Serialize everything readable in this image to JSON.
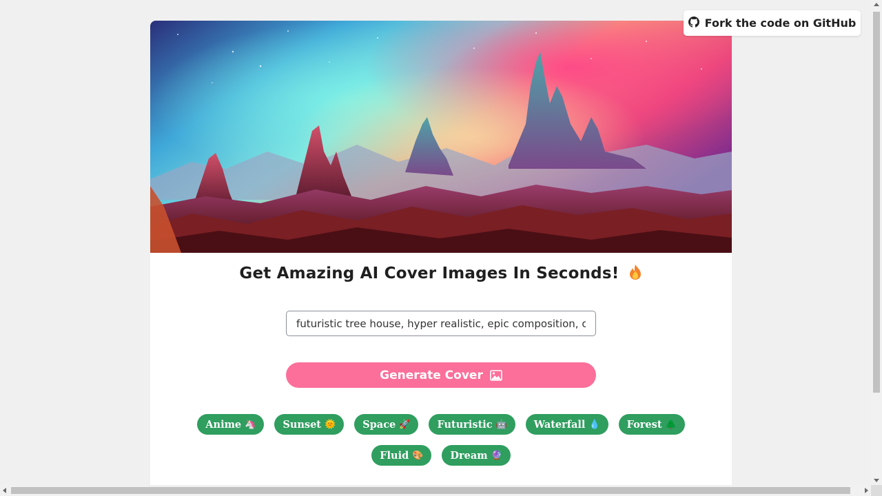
{
  "github": {
    "label": "Fork the code on GitHub",
    "icon": "github-icon"
  },
  "hero": {
    "alt": "AI generated alien mountain landscape under colorful nebula sky"
  },
  "headline": {
    "text": "Get Amazing AI Cover Images In Seconds!",
    "icon": "flame-icon"
  },
  "prompt": {
    "value": "futuristic tree house, hyper realistic, epic composition, cinematic"
  },
  "generate": {
    "label": "Generate Cover",
    "icon": "image-icon"
  },
  "tags": [
    {
      "label": "Anime",
      "emoji": "🦄"
    },
    {
      "label": "Sunset",
      "emoji": "🌞"
    },
    {
      "label": "Space",
      "emoji": "🚀"
    },
    {
      "label": "Futuristic",
      "emoji": "🤖"
    },
    {
      "label": "Waterfall",
      "emoji": "💧"
    },
    {
      "label": "Forest",
      "emoji": "🌲"
    },
    {
      "label": "Fluid",
      "emoji": "🎨"
    },
    {
      "label": "Dream",
      "emoji": "🔮"
    }
  ],
  "colors": {
    "page_bg": "#f0f0f0",
    "generate_bg": "#fb6f9a",
    "tag_bg": "#2f9e5f"
  }
}
